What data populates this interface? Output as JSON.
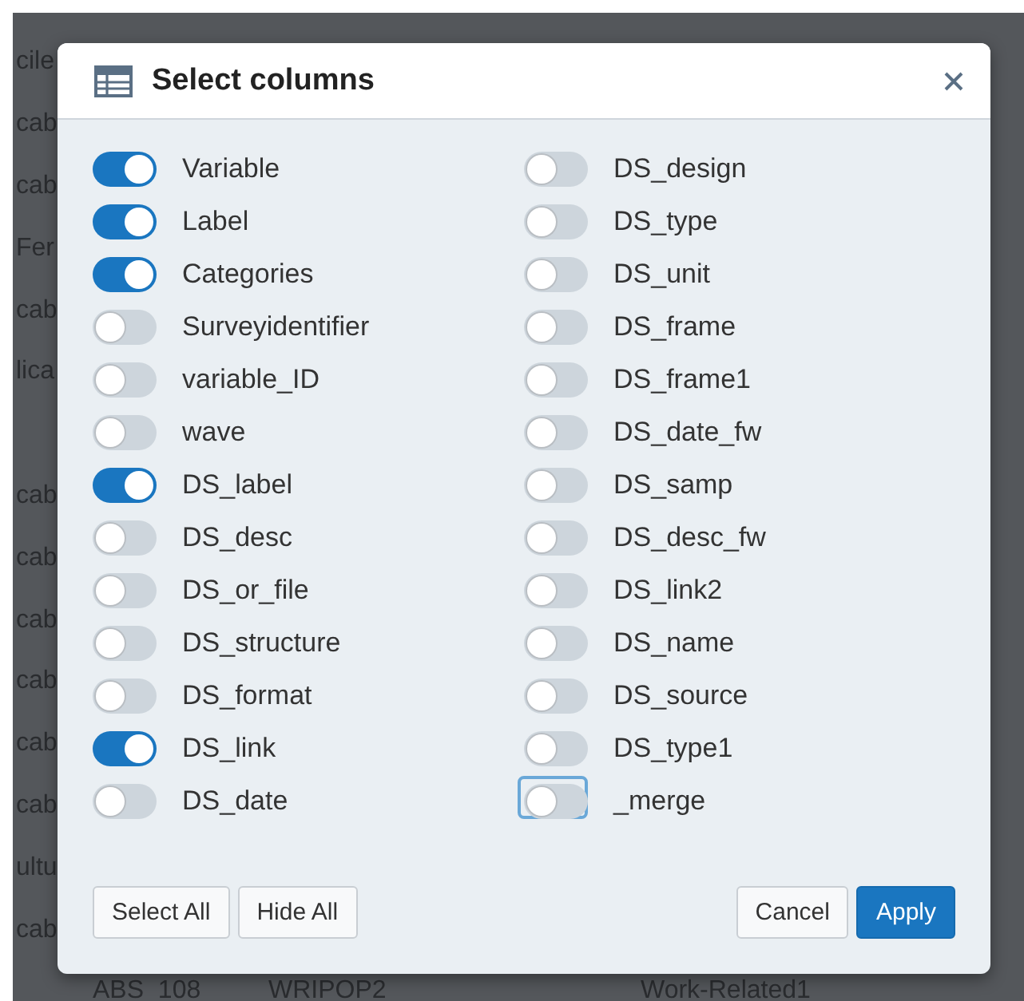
{
  "background_table": {
    "rows": [
      {
        "column_1": "cile"
      },
      {
        "column_1": "cab"
      },
      {
        "column_1": "cab"
      },
      {
        "column_1": "Fer"
      },
      {
        "column_1": "cab"
      },
      {
        "column_1": "lica"
      },
      {
        "column_1": ""
      },
      {
        "column_1": "cab"
      },
      {
        "column_1": "cab"
      },
      {
        "column_1": "cab"
      },
      {
        "column_1": "cab"
      },
      {
        "column_1": "cab"
      },
      {
        "column_1": "cab"
      },
      {
        "column_1": "ultu"
      },
      {
        "column_1": "cab"
      },
      {
        "column_1": "ABS_108",
        "column_2": "WRIPOP2",
        "column_3": "Work-Related1"
      }
    ]
  },
  "dialog": {
    "title": "Select columns",
    "columns": [
      [
        {
          "label": "Variable",
          "on": true,
          "focused": false
        },
        {
          "label": "Label",
          "on": true,
          "focused": false
        },
        {
          "label": "Categories",
          "on": true,
          "focused": false
        },
        {
          "label": "Surveyidentifier",
          "on": false,
          "focused": false
        },
        {
          "label": "variable_ID",
          "on": false,
          "focused": false
        },
        {
          "label": "wave",
          "on": false,
          "focused": false
        },
        {
          "label": "DS_label",
          "on": true,
          "focused": false
        },
        {
          "label": "DS_desc",
          "on": false,
          "focused": false
        },
        {
          "label": "DS_or_file",
          "on": false,
          "focused": false
        },
        {
          "label": "DS_structure",
          "on": false,
          "focused": false
        },
        {
          "label": "DS_format",
          "on": false,
          "focused": false
        },
        {
          "label": "DS_link",
          "on": true,
          "focused": false
        },
        {
          "label": "DS_date",
          "on": false,
          "focused": false
        }
      ],
      [
        {
          "label": "DS_design",
          "on": false,
          "focused": false
        },
        {
          "label": "DS_type",
          "on": false,
          "focused": false
        },
        {
          "label": "DS_unit",
          "on": false,
          "focused": false
        },
        {
          "label": "DS_frame",
          "on": false,
          "focused": false
        },
        {
          "label": "DS_frame1",
          "on": false,
          "focused": false
        },
        {
          "label": "DS_date_fw",
          "on": false,
          "focused": false
        },
        {
          "label": "DS_samp",
          "on": false,
          "focused": false
        },
        {
          "label": "DS_desc_fw",
          "on": false,
          "focused": false
        },
        {
          "label": "DS_link2",
          "on": false,
          "focused": false
        },
        {
          "label": "DS_name",
          "on": false,
          "focused": false
        },
        {
          "label": "DS_source",
          "on": false,
          "focused": false
        },
        {
          "label": "DS_type1",
          "on": false,
          "focused": false
        },
        {
          "label": "_merge",
          "on": false,
          "focused": true
        }
      ]
    ],
    "left_buttons": [
      "Select All",
      "Hide All"
    ],
    "right_buttons": [
      {
        "label": "Cancel",
        "kind": "default"
      },
      {
        "label": "Apply",
        "kind": "primary"
      }
    ]
  }
}
